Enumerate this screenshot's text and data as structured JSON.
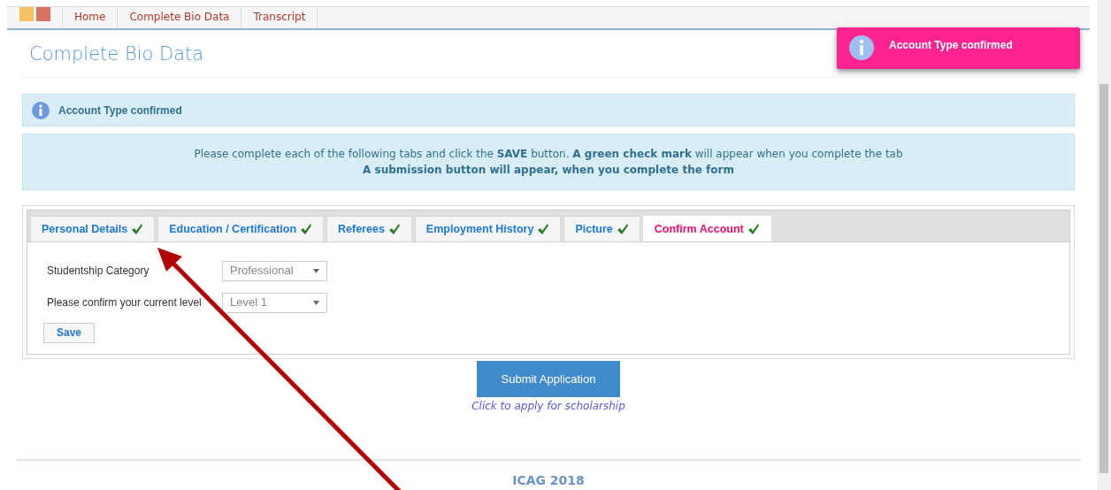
{
  "nav": {
    "items": [
      {
        "label": "Home"
      },
      {
        "label": "Complete Bio Data"
      },
      {
        "label": "Transcript"
      }
    ]
  },
  "page_title": "Complete Bio Data",
  "toast": {
    "text": "Account Type confirmed"
  },
  "info_alert": {
    "text": "Account Type confirmed"
  },
  "instructions": [
    "Please complete each of the following tabs and click the **SAVE** button. **A green check mark** will appear when you complete the tab",
    "A submission button will appear, when you complete the form"
  ],
  "tabs": [
    {
      "label": "Personal Details",
      "selected": false,
      "checked": true
    },
    {
      "label": "Education / Certification",
      "selected": false,
      "checked": true
    },
    {
      "label": "Referees",
      "selected": false,
      "checked": true
    },
    {
      "label": "Employment History",
      "selected": false,
      "checked": true
    },
    {
      "label": "Picture",
      "selected": false,
      "checked": true
    },
    {
      "label": "Confirm Account",
      "selected": true,
      "checked": true
    }
  ],
  "form": {
    "fields": [
      {
        "label": "Studentship Category",
        "value": "Professional"
      },
      {
        "label": "Please confirm your current level",
        "value": "Level 1"
      }
    ],
    "save_button": "Save"
  },
  "submit_button": "Submit Application",
  "submit_hint": "Click to apply for scholarship",
  "footer": "ICAG 2018"
}
